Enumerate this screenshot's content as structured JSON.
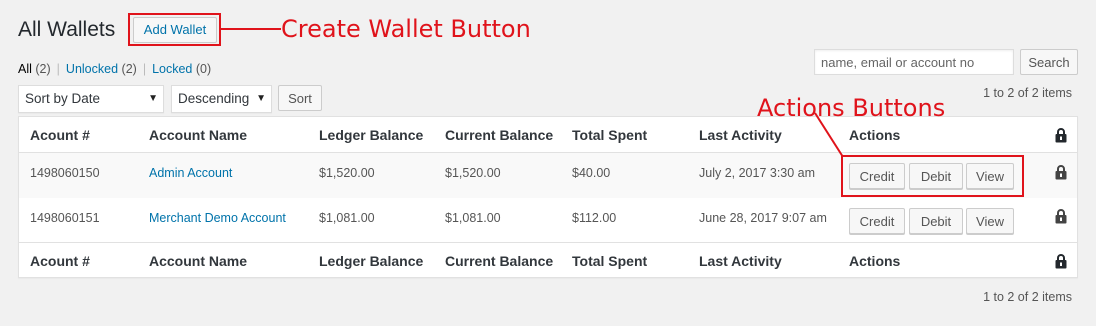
{
  "header": {
    "title": "All Wallets",
    "add_wallet_label": "Add Wallet"
  },
  "annotations": {
    "create_wallet": "Create Wallet Button",
    "actions": "Actions Buttons",
    "color": "#e0131b"
  },
  "filters": {
    "all_label": "All",
    "all_count": "(2)",
    "unlocked_label": "Unlocked",
    "unlocked_count": "(2)",
    "locked_label": "Locked",
    "locked_count": "(0)",
    "separator": "|"
  },
  "search": {
    "placeholder": "name, email or account no",
    "button_label": "Search"
  },
  "sort": {
    "sort_by": "Sort by Date",
    "order": "Descending",
    "button_label": "Sort"
  },
  "pagination": {
    "items_text": "1 to 2 of 2 items"
  },
  "table": {
    "columns": [
      "Acount #",
      "Account Name",
      "Ledger Balance",
      "Current Balance",
      "Total Spent",
      "Last Activity",
      "Actions"
    ],
    "rows": [
      {
        "account_no": "1498060150",
        "account_name": "Admin Account",
        "ledger_balance": "$1,520.00",
        "current_balance": "$1,520.00",
        "total_spent": "$40.00",
        "last_activity": "July 2, 2017 3:30 am"
      },
      {
        "account_no": "1498060151",
        "account_name": "Merchant Demo Account",
        "ledger_balance": "$1,081.00",
        "current_balance": "$1,081.00",
        "total_spent": "$112.00",
        "last_activity": "June 28, 2017 9:07 am"
      }
    ],
    "actions": {
      "credit": "Credit",
      "debit": "Debit",
      "view": "View"
    },
    "lock_icon": "lock-icon"
  }
}
